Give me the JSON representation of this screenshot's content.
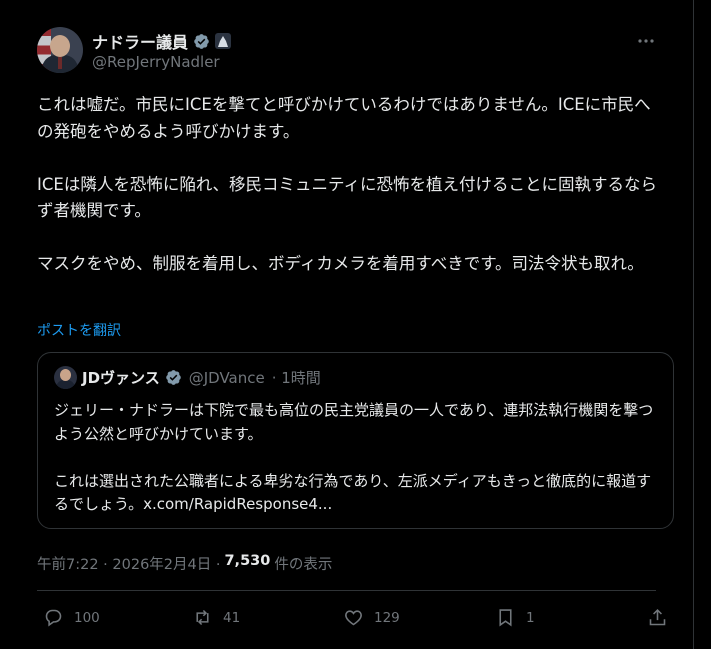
{
  "author": {
    "display_name": "ナドラー議員",
    "handle": "@RepJerryNadler"
  },
  "tweet": {
    "text": "これは嘘だ。市民にICEを撃てと呼びかけているわけではありません。ICEに市民への発砲をやめるよう呼びかけます。\n\nICEは隣人を恐怖に陥れ、移民コミュニティに恐怖を植え付けることに固執するならず者機関です。\n\nマスクをやめ、制服を着用し、ボディカメラを着用すべきです。司法令状も取れ。",
    "translate_label": "ポストを翻訳"
  },
  "quote": {
    "display_name": "JDヴァンス",
    "handle": "@JDVance",
    "time": "· 1時間",
    "text": "ジェリー・ナドラーは下院で最も高位の民主党議員の一人であり、連邦法執行機関を撃つよう公然と呼びかけています。\n\nこれは選出された公職者による卑劣な行為であり、左派メディアもきっと徹底的に報道するでしょう。x.com/RapidResponse4..."
  },
  "meta": {
    "timestamp": "午前7:22 · 2026年2月4日 ·",
    "views": "7,530",
    "views_label": "件の表示"
  },
  "actions": {
    "replies": "100",
    "reposts": "41",
    "likes": "129",
    "bookmarks": "1"
  },
  "icons": {
    "verified": "verified-check-icon",
    "gov": "government-badge-icon",
    "more": "more-dots-icon",
    "reply": "reply-icon",
    "repost": "repost-icon",
    "like": "heart-icon",
    "bookmark": "bookmark-icon",
    "share": "share-icon"
  },
  "colors": {
    "background": "#000000",
    "text": "#e7e9ea",
    "muted": "#71767b",
    "link": "#1d9bf0",
    "border": "#2f3336",
    "verified": "#829aab"
  }
}
